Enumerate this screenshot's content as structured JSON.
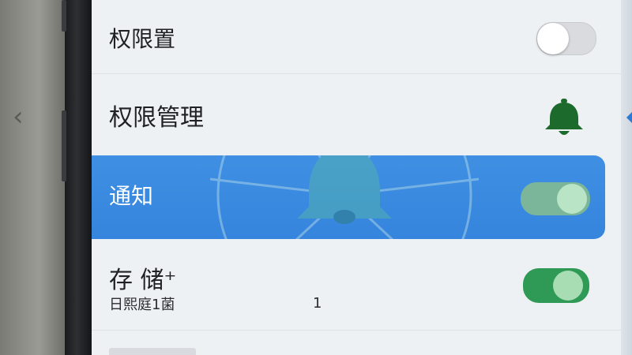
{
  "rows": {
    "permission_set": {
      "label": "权限置",
      "toggle_on": false
    },
    "permission_manage": {
      "label": "权限管理",
      "icon": "bell-icon"
    },
    "notification": {
      "label": "通知",
      "toggle_on": true,
      "selected": true
    },
    "storage": {
      "label": "存 储⁺",
      "sublabel": "日熙庭1菌",
      "count": "1",
      "toggle_on": true
    }
  },
  "colors": {
    "accent": "#3585de",
    "toggle_on": "#2e9a55",
    "toggle_off": "#d9dbde",
    "bell": "#1d6b2c"
  }
}
